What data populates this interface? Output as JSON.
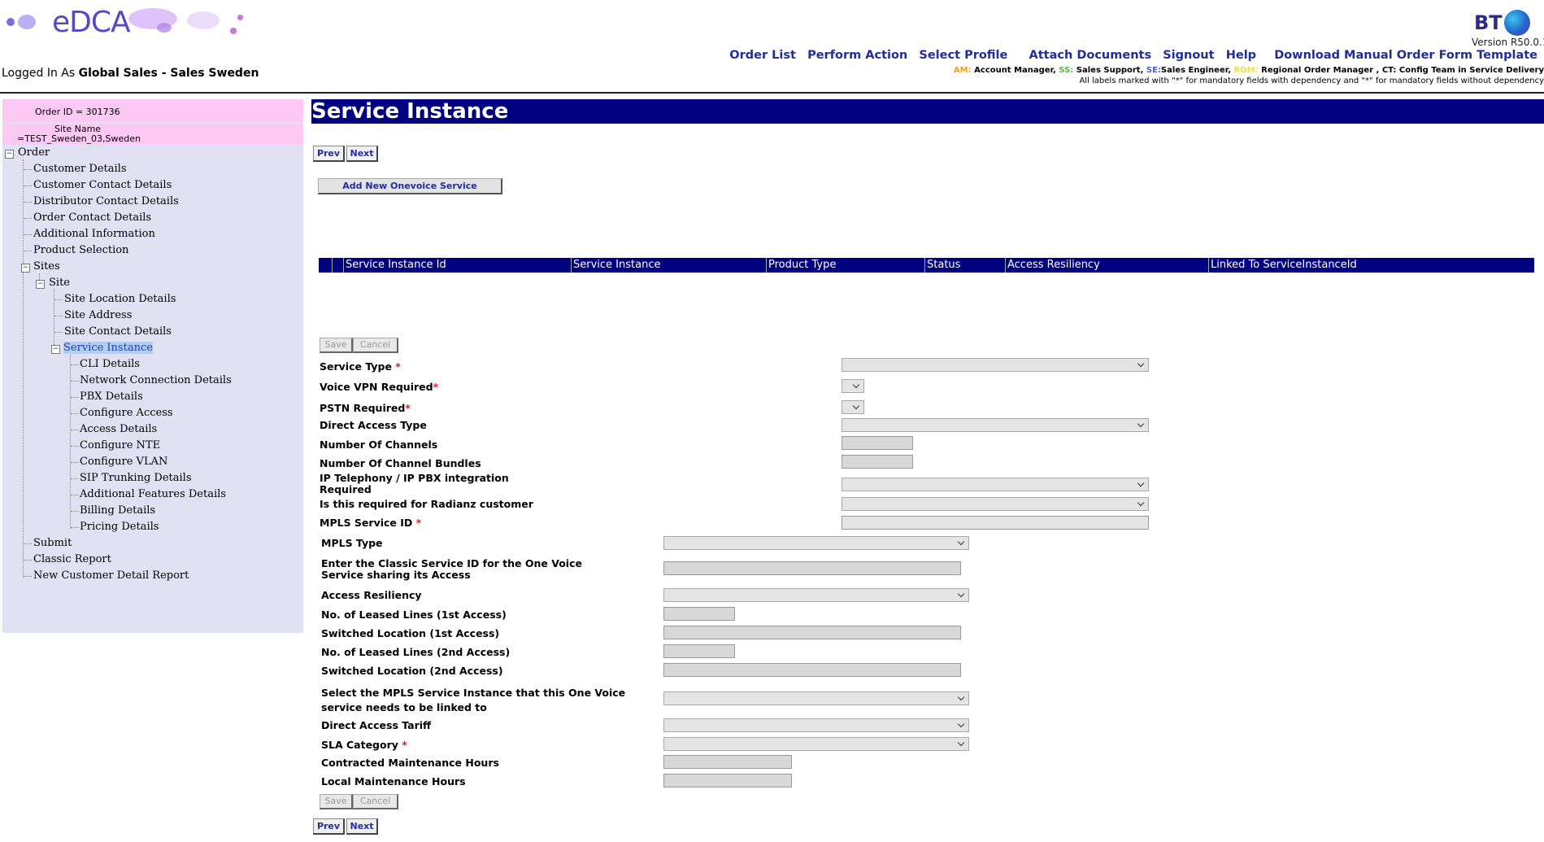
{
  "header": {
    "logo_text": "eDCA",
    "logged_in_prefix": "Logged In As",
    "logged_in_user": "Global Sales - Sales Sweden",
    "brand": "BT",
    "version": "Version R50.0.1",
    "nav": [
      "Order List",
      "Perform Action",
      "Select Profile",
      "Attach Documents",
      "Signout",
      "Help",
      "Download Manual Order Form Template"
    ],
    "legend_line1": [
      {
        "abbr": "AM:",
        "text": " Account Manager, ",
        "color": "#e8a21c"
      },
      {
        "abbr": "SS:",
        "text": " Sales Support, ",
        "color": "#5bb347"
      },
      {
        "abbr": "SE:",
        "text": "Sales Engineer, ",
        "color": "#3a66d6"
      },
      {
        "abbr": "ROM:",
        "text": " Regional Order Manager , CT: Config Team in Service Delivery",
        "color": "#f0e23a"
      }
    ],
    "legend_line2": "All labels marked with \"*\" for mandatory fields with dependency and \"*\" for mandatory fields without dependency"
  },
  "sidebar": {
    "order_id": "Order ID = 301736",
    "site_name_label": "Site Name",
    "site_name_value": "=TEST_Sweden_03,Sweden",
    "tree": {
      "order": "Order",
      "order_items": [
        "Customer Details",
        "Customer Contact Details",
        "Distributor Contact Details",
        "Order Contact Details",
        "Additional Information",
        "Product Selection"
      ],
      "sites": "Sites",
      "site": "Site",
      "site_items": [
        "Site Location Details",
        "Site Address",
        "Site Contact Details"
      ],
      "service_instance": "Service Instance",
      "service_items": [
        "CLI Details",
        "Network Connection Details",
        "PBX Details",
        "Configure Access",
        "Access Details",
        "Configure NTE",
        "Configure VLAN",
        "SIP Trunking Details",
        "Additional Features Details",
        "Billing Details",
        "Pricing Details"
      ],
      "tail_items": [
        "Submit",
        "Classic Report",
        "New Customer Detail Report"
      ]
    }
  },
  "main": {
    "title": "Service Instance",
    "prev": "Prev",
    "next": "Next",
    "add_button": "Add New Onevoice Service",
    "table_headers": [
      "",
      "Service Instance Id",
      "Service Instance",
      "Product Type",
      "Status",
      "Access Resiliency",
      "Linked To ServiceInstanceId"
    ],
    "save": "Save",
    "cancel": "Cancel",
    "form1": [
      {
        "label": "Service Type",
        "req": true,
        "field": "select-wide"
      },
      {
        "label": "Voice VPN Required",
        "req": true,
        "field": "select-tiny"
      },
      {
        "label": "PSTN Required",
        "req": true,
        "field": "select-tiny"
      },
      {
        "label": "Direct Access Type",
        "req": false,
        "field": "select-wide"
      },
      {
        "label": "Number Of Channels",
        "req": false,
        "field": "input-small"
      },
      {
        "label": "Number Of Channel Bundles",
        "req": false,
        "field": "input-small"
      },
      {
        "label": "IP Telephony / IP PBX integration Required",
        "req": false,
        "field": "select-wide"
      },
      {
        "label": "Is this required for Radianz customer",
        "req": false,
        "field": "select-wide"
      },
      {
        "label": "MPLS Service ID",
        "req": true,
        "field": "input-wide"
      }
    ],
    "form2": [
      {
        "label": "MPLS Type",
        "req": false,
        "field": "select"
      },
      {
        "label": "Enter the Classic Service ID for the One Voice Service sharing its Access",
        "req": false,
        "field": "input"
      },
      {
        "label": "Access Resiliency",
        "req": false,
        "field": "select"
      },
      {
        "label": "No. of Leased Lines (1st Access)",
        "req": false,
        "field": "input-small"
      },
      {
        "label": "Switched Location (1st Access)",
        "req": false,
        "field": "input"
      },
      {
        "label": "No. of Leased Lines (2nd Access)",
        "req": false,
        "field": "input-small"
      },
      {
        "label": "Switched Location (2nd Access)",
        "req": false,
        "field": "input"
      },
      {
        "label": "Select the MPLS Service Instance that this One Voice service needs to be linked to",
        "req": false,
        "field": "select"
      },
      {
        "label": "Direct Access Tariff",
        "req": false,
        "field": "select"
      },
      {
        "label": "SLA Category",
        "req": true,
        "field": "select"
      },
      {
        "label": "Contracted Maintenance Hours",
        "req": false,
        "field": "input-mid"
      },
      {
        "label": "Local Maintenance Hours",
        "req": false,
        "field": "input-mid"
      }
    ]
  }
}
